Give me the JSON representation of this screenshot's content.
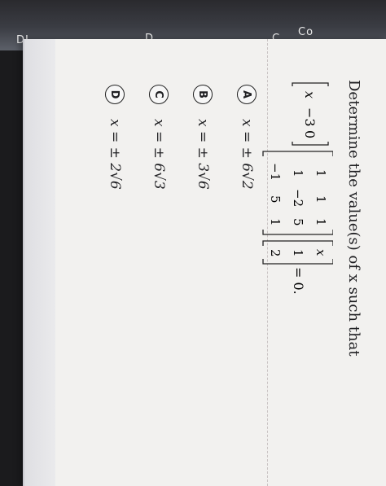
{
  "screen": {
    "fragments": [
      "Co",
      "C",
      "D",
      "DL"
    ]
  },
  "question": {
    "prompt": "Determine the value(s) of x such that",
    "row_vector": [
      "x",
      "−3",
      "0"
    ],
    "matrix": [
      [
        "1",
        "1",
        "1"
      ],
      [
        "1",
        "−2",
        "5"
      ],
      [
        "−1",
        "5",
        "1"
      ]
    ],
    "col_vector": [
      "x",
      "1",
      "2"
    ],
    "rhs": "= 0."
  },
  "options": [
    {
      "letter": "A",
      "text": "x = ± 6√2"
    },
    {
      "letter": "B",
      "text": "x = ± 3√6"
    },
    {
      "letter": "C",
      "text": "x = ± 6√3"
    },
    {
      "letter": "D",
      "text": "x = ± 2√6"
    }
  ]
}
